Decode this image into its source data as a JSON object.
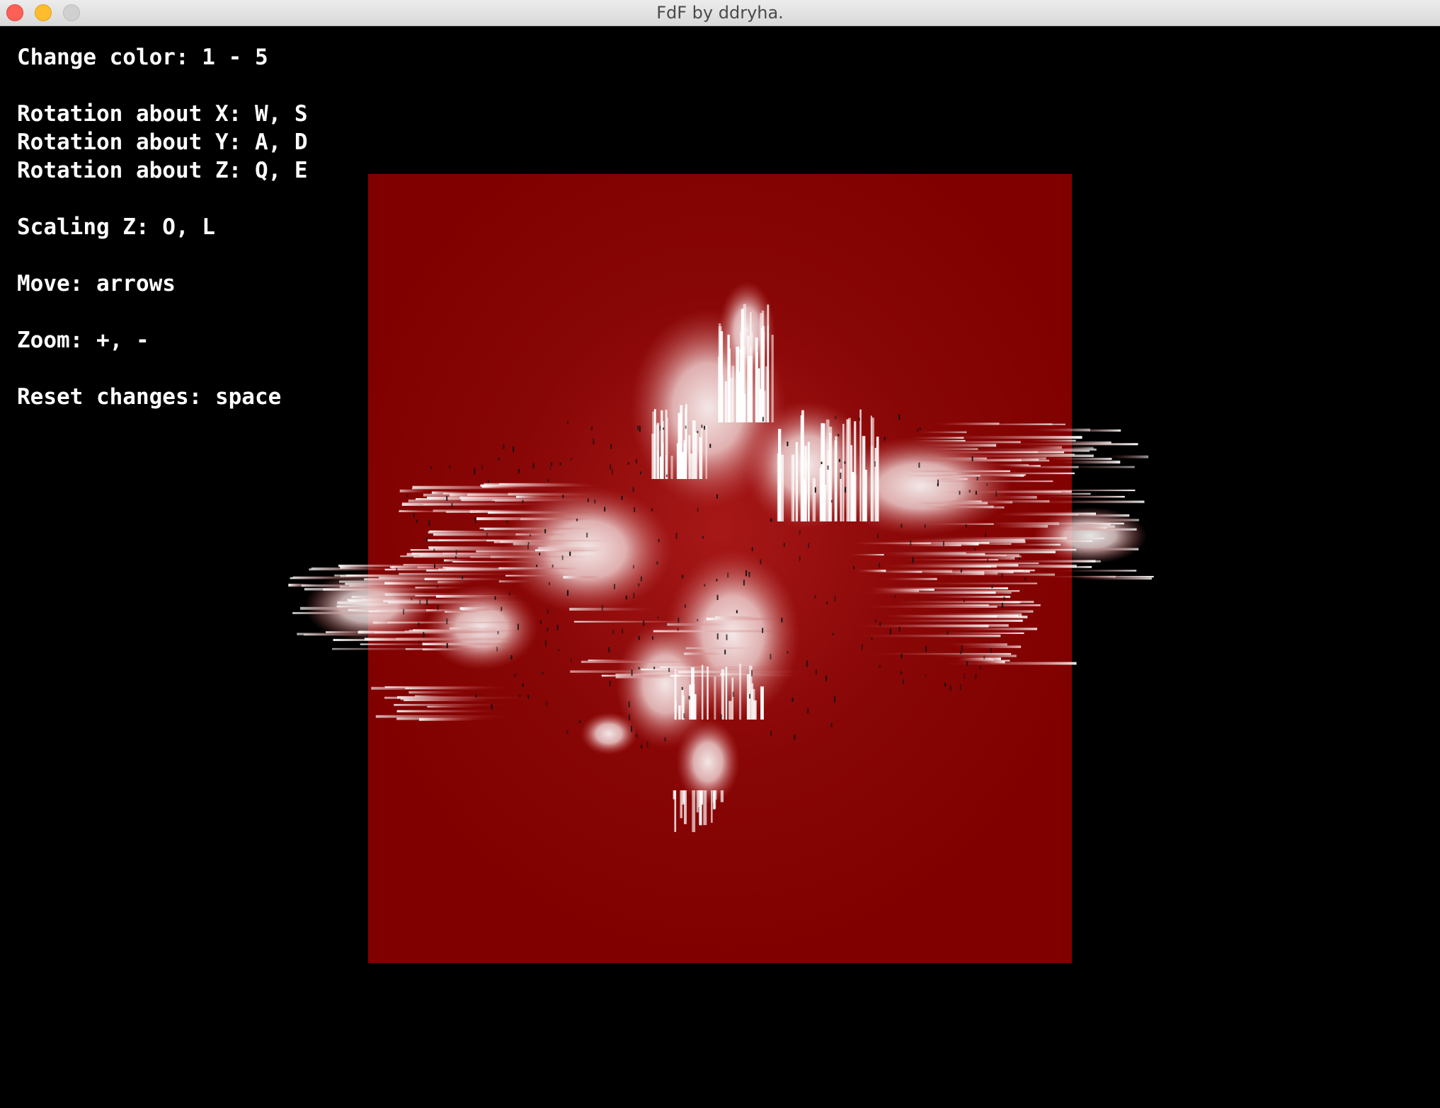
{
  "window": {
    "title": "FdF by ddryha."
  },
  "help": {
    "color": "Change color: 1 - 5",
    "rot_x": "Rotation about X: W, S",
    "rot_y": "Rotation about Y: A, D",
    "rot_z": "Rotation about Z: Q, E",
    "scale_z": "Scaling Z: O, L",
    "move": "Move: arrows",
    "zoom": "Zoom: +, -",
    "reset": "Reset changes: space"
  },
  "render": {
    "plane_color": "#800000",
    "highlight_color": "#ffffff",
    "background_color": "#000000"
  }
}
